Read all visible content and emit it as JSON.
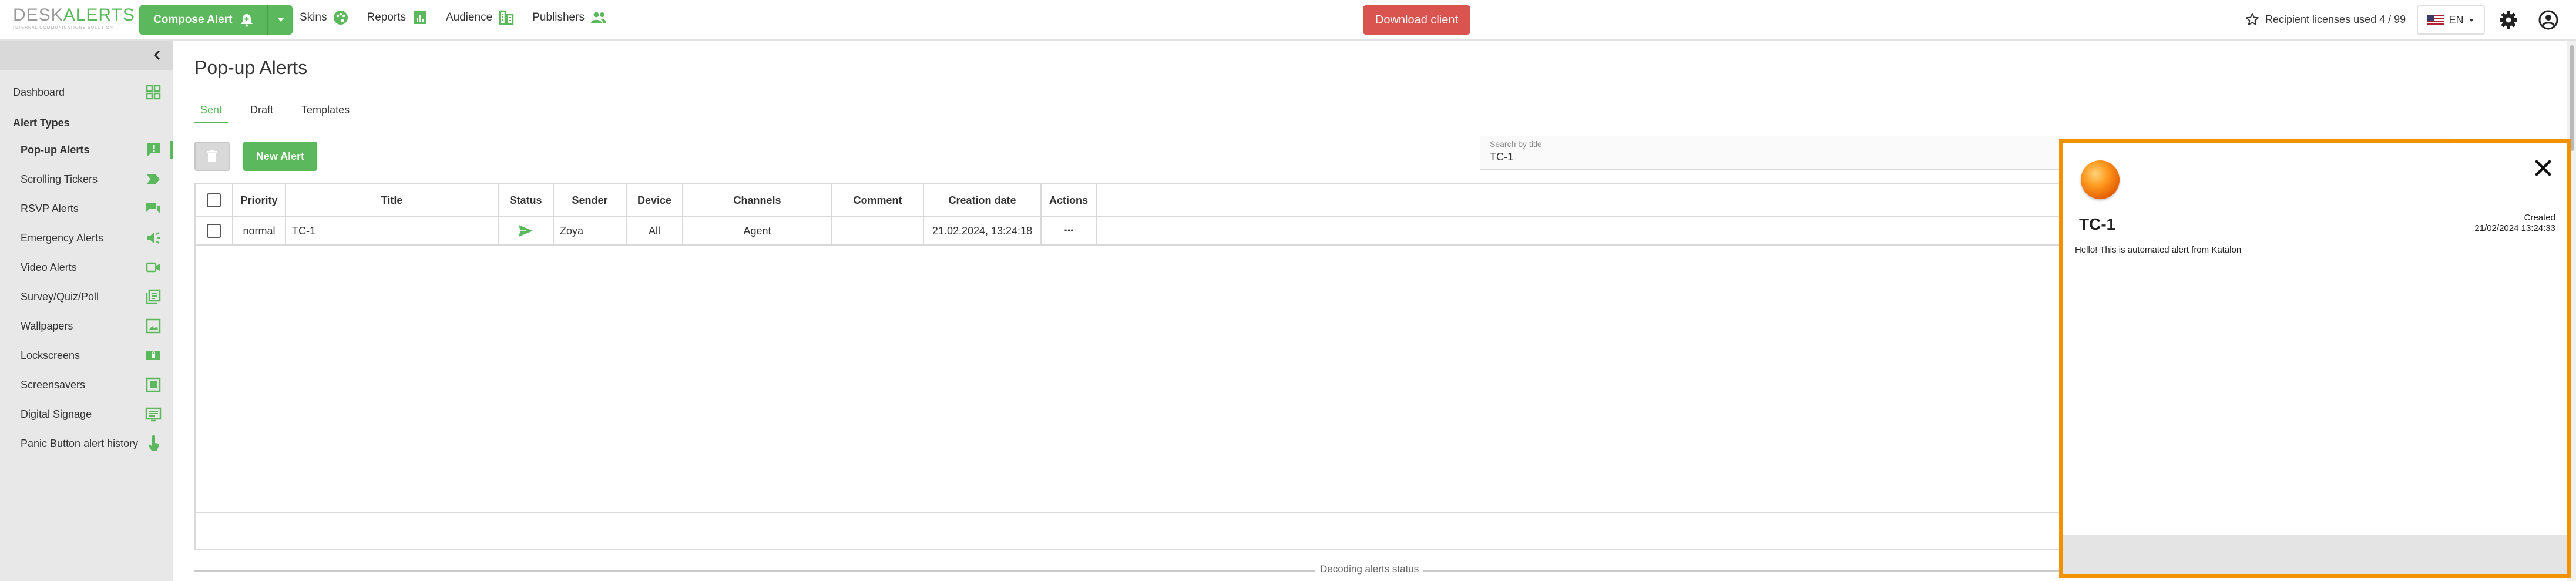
{
  "header": {
    "logo_text_plain": "DESK",
    "logo_text_accent": "ALERTS",
    "logo_tagline": "INTERNAL COMMUNICATIONS SOLUTION",
    "compose_label": "Compose Alert",
    "nav": [
      {
        "label": "Skins",
        "icon": "palette-icon"
      },
      {
        "label": "Reports",
        "icon": "chart-icon"
      },
      {
        "label": "Audience",
        "icon": "org-chart-icon"
      },
      {
        "label": "Publishers",
        "icon": "people-icon"
      }
    ],
    "download_label": "Download client",
    "licenses_label": "Recipient licenses used 4 / 99",
    "language": "EN",
    "accent_color": "#5cb85c",
    "danger_color": "#d9534f"
  },
  "sidebar": {
    "dashboard_label": "Dashboard",
    "section_label": "Alert Types",
    "items": [
      {
        "label": "Pop-up Alerts",
        "icon": "popup-alert-icon",
        "active": true
      },
      {
        "label": "Scrolling Tickers",
        "icon": "ticker-icon"
      },
      {
        "label": "RSVP Alerts",
        "icon": "rsvp-icon"
      },
      {
        "label": "Emergency Alerts",
        "icon": "emergency-icon"
      },
      {
        "label": "Video Alerts",
        "icon": "video-icon"
      },
      {
        "label": "Survey/Quiz/Poll",
        "icon": "survey-icon"
      },
      {
        "label": "Wallpapers",
        "icon": "wallpaper-icon"
      },
      {
        "label": "Lockscreens",
        "icon": "lockscreen-icon"
      },
      {
        "label": "Screensavers",
        "icon": "screensaver-icon"
      },
      {
        "label": "Digital Signage",
        "icon": "signage-icon"
      },
      {
        "label": "Panic Button alert history",
        "icon": "panic-button-icon"
      }
    ]
  },
  "main": {
    "title": "Pop-up Alerts",
    "tabs": [
      "Sent",
      "Draft",
      "Templates"
    ],
    "active_tab": "Sent",
    "new_alert_label": "New Alert",
    "search": {
      "label": "Search by title",
      "value": "TC-1"
    },
    "table": {
      "headers": [
        "Priority",
        "Title",
        "Status",
        "Sender",
        "Device",
        "Channels",
        "Comment",
        "Creation date",
        "Actions"
      ],
      "rows": [
        {
          "priority": "normal",
          "title": "TC-1",
          "status": "sent-icon",
          "sender": "Zoya",
          "device": "All",
          "channels": "Agent",
          "comment": "",
          "creation_date": "21.02.2024, 13:24:18",
          "actions": "···"
        }
      ]
    },
    "decoding_label": "Decoding alerts status"
  },
  "popup": {
    "title": "TC-1",
    "created_label": "Created",
    "created_value": "21/02/2024 13:24:33",
    "body": "Hello! This is automated alert from Katalon",
    "border_color": "#f39200"
  }
}
